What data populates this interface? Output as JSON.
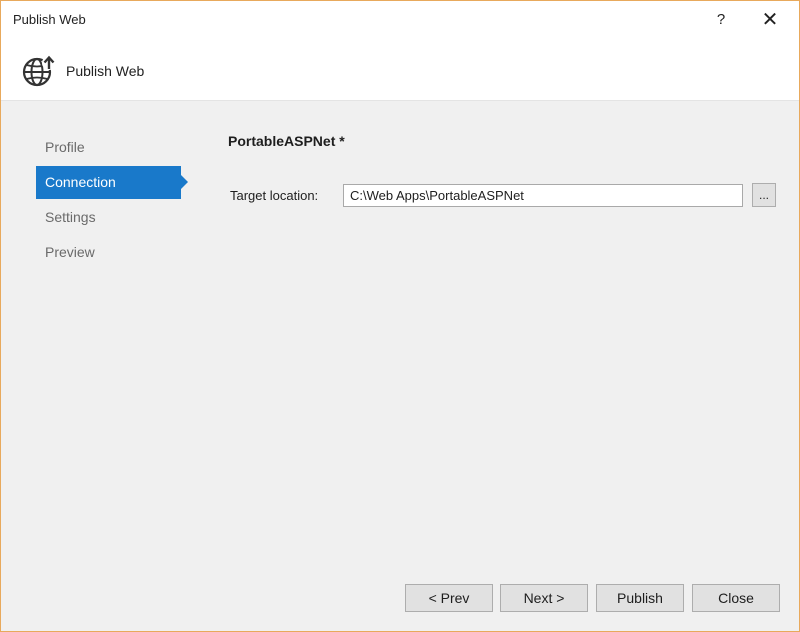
{
  "window": {
    "title": "Publish Web",
    "help_glyph": "?",
    "close_glyph": "✕"
  },
  "header": {
    "title": "Publish Web",
    "icon": "globe-publish-icon"
  },
  "nav": {
    "items": [
      {
        "label": "Profile",
        "active": false
      },
      {
        "label": "Connection",
        "active": true
      },
      {
        "label": "Settings",
        "active": false
      },
      {
        "label": "Preview",
        "active": false
      }
    ]
  },
  "main": {
    "profile_name": "PortableASPNet *",
    "target_location_label": "Target location:",
    "target_location_value": "C:\\Web Apps\\PortableASPNet",
    "browse_label": "..."
  },
  "footer": {
    "prev_label": "< Prev",
    "next_label": "Next >",
    "publish_label": "Publish",
    "close_label": "Close"
  },
  "colors": {
    "accent": "#1979ca",
    "window_border": "#e8a95c",
    "background": "#f0f0f0"
  }
}
